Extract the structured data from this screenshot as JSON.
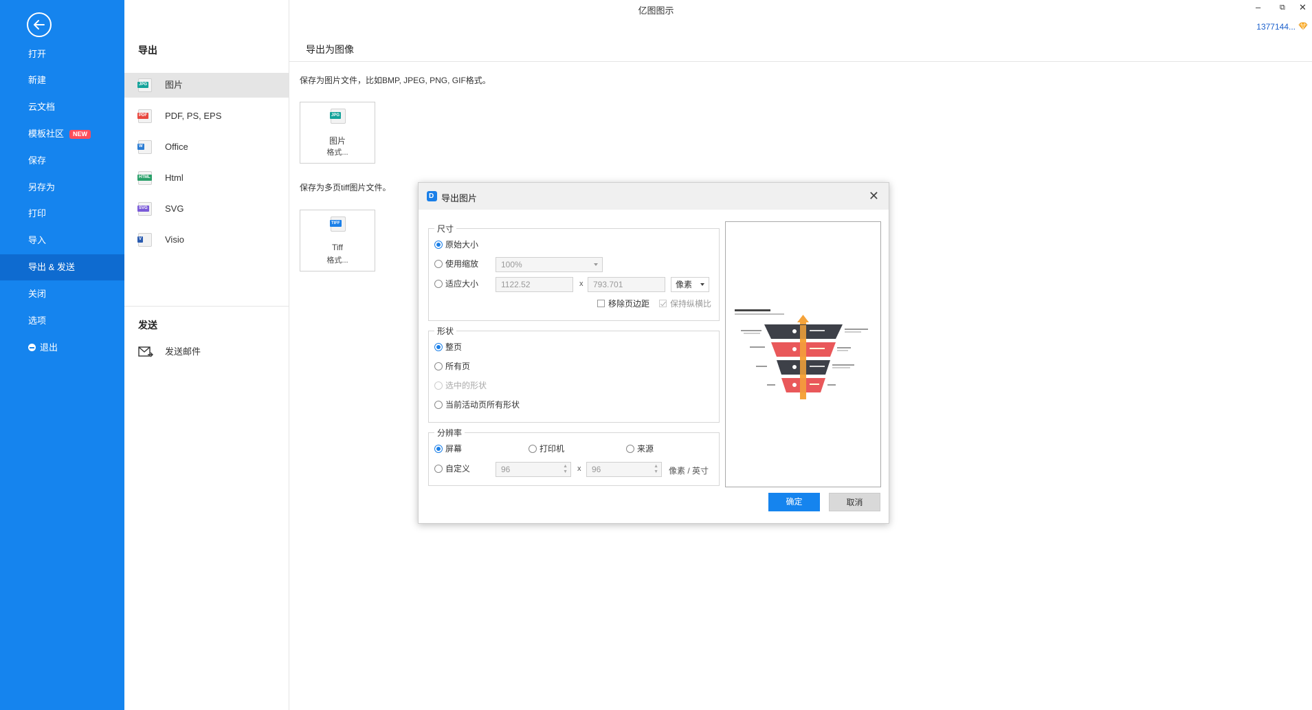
{
  "app_title": "亿图图示",
  "user": {
    "name": "1377144..."
  },
  "sidebar": {
    "items": [
      {
        "label": "打开"
      },
      {
        "label": "新建"
      },
      {
        "label": "云文档"
      },
      {
        "label": "模板社区",
        "badge": "NEW"
      },
      {
        "label": "保存"
      },
      {
        "label": "另存为"
      },
      {
        "label": "打印"
      },
      {
        "label": "导入"
      },
      {
        "label": "导出 & 发送",
        "active": true
      },
      {
        "label": "关闭"
      },
      {
        "label": "选项"
      },
      {
        "label": "退出"
      }
    ]
  },
  "export_panel": {
    "title": "导出",
    "formats": [
      {
        "label": "图片",
        "icon": "JPG",
        "color": "#15a39a"
      },
      {
        "label": "PDF, PS, EPS",
        "icon": "PDF",
        "color": "#e8473e"
      },
      {
        "label": "Office",
        "icon": "W",
        "color": "#2b7cd3"
      },
      {
        "label": "Html",
        "icon": "HTML",
        "color": "#2aa06a"
      },
      {
        "label": "SVG",
        "icon": "SVG",
        "color": "#7a5ad8"
      },
      {
        "label": "Visio",
        "icon": "V",
        "color": "#2b5cb0"
      }
    ],
    "send_title": "发送",
    "send_items": [
      {
        "label": "发送邮件"
      }
    ]
  },
  "content": {
    "title": "导出为图像",
    "image_desc": "保存为图片文件，比如BMP, JPEG, PNG, GIF格式。",
    "image_tile": {
      "icon": "JPG",
      "line1": "图片",
      "line2": "格式..."
    },
    "tiff_desc": "保存为多页tiff图片文件。",
    "tiff_tile": {
      "icon": "TIFF",
      "line1": "Tiff",
      "line2": "格式..."
    }
  },
  "dialog": {
    "title": "导出图片",
    "size": {
      "label": "尺寸",
      "original": "原始大小",
      "use_zoom": "使用缩放",
      "zoom_value": "100%",
      "fit": "适应大小",
      "width": "1122.52",
      "height": "793.701",
      "unit": "像素",
      "x": "x",
      "remove_margin": "移除页边距",
      "keep_ratio": "保持纵横比"
    },
    "shape": {
      "label": "形状",
      "whole_page": "整页",
      "all_pages": "所有页",
      "selected": "选中的形状",
      "current_page_all": "当前活动页所有形状"
    },
    "resolution": {
      "label": "分辨率",
      "screen": "屏幕",
      "printer": "打印机",
      "source": "来源",
      "custom": "自定义",
      "dpi_x": "96",
      "dpi_y": "96",
      "x": "x",
      "unit": "像素 / 英寸"
    },
    "ok": "确定",
    "cancel": "取消"
  }
}
